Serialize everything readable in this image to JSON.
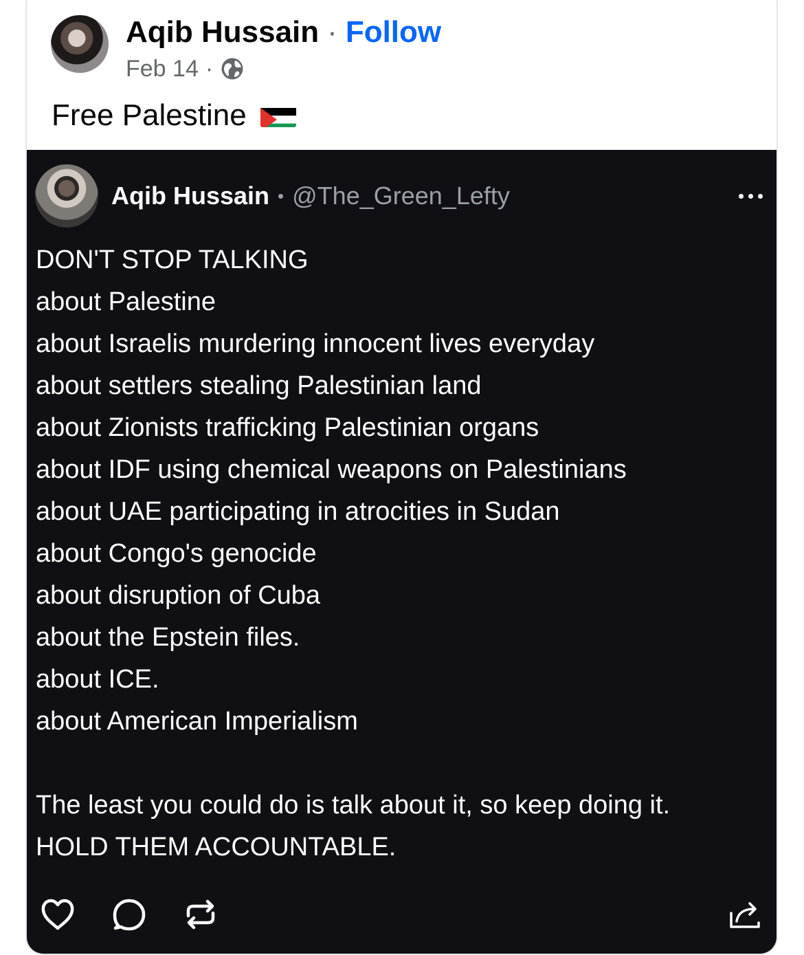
{
  "post": {
    "author": "Aqib Hussain",
    "separator": "·",
    "follow_label": "Follow",
    "date": "Feb 14",
    "meta_separator": "·",
    "privacy_icon": "globe-icon",
    "caption": "Free Palestine",
    "caption_emoji": "palestine-flag-emoji"
  },
  "embed": {
    "name": "Aqib Hussain",
    "separator": "•",
    "handle": "@The_Green_Lefty",
    "more_icon": "more-options-icon",
    "lines": [
      "DON'T STOP TALKING",
      "about Palestine",
      "about Israelis murdering innocent lives everyday",
      "about settlers stealing Palestinian land",
      "about Zionists trafficking Palestinian organs",
      "about IDF using chemical weapons on Palestinians",
      "about UAE participating in atrocities in Sudan",
      "about Congo's genocide",
      "about disruption of Cuba",
      "about the Epstein files.",
      "about ICE.",
      "about American Imperialism"
    ],
    "closing": [
      "The least you could do is talk about it, so keep doing it.",
      "HOLD THEM ACCOUNTABLE."
    ],
    "actions": [
      "heart-icon",
      "comment-icon",
      "repost-icon",
      "share-icon"
    ]
  },
  "colors": {
    "link": "#0866ff",
    "embed_bg": "#0f0f14",
    "muted": "#65676b"
  }
}
